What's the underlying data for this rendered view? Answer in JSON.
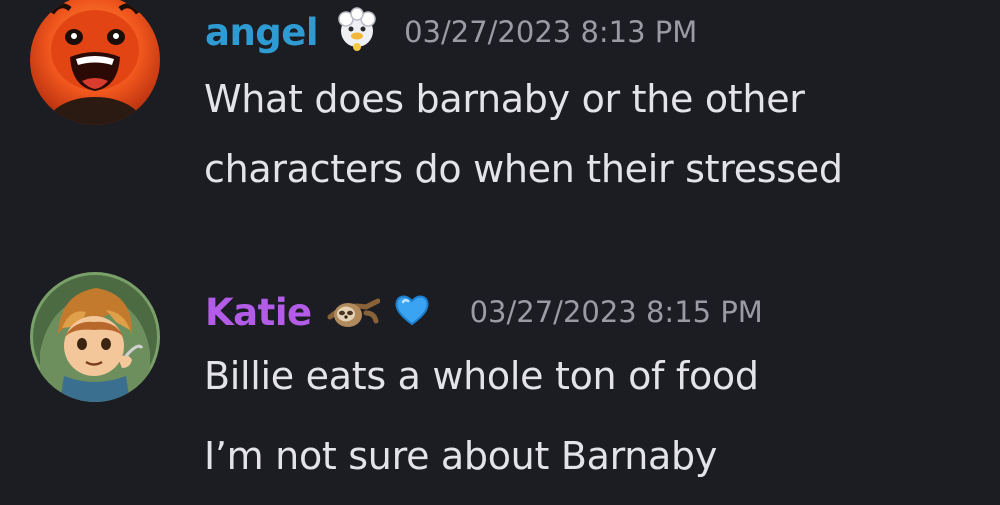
{
  "messages": [
    {
      "author": {
        "name": "angel",
        "color": "#2f9bd3",
        "avatar": "orange-screaming-character-avatar",
        "badges": [
          "white-flower-duck-icon"
        ]
      },
      "timestamp": "03/27/2023 8:13 PM",
      "lines": [
        "What does barnaby or the other",
        "characters do when their stressed"
      ]
    },
    {
      "author": {
        "name": "Katie",
        "color": "#b35ce8",
        "avatar": "brown-haired-character-avatar",
        "badges": [
          "sloth-emoji-icon",
          "blue-heart-icon"
        ]
      },
      "timestamp": "03/27/2023 8:15 PM",
      "lines": [
        "Billie eats a whole ton of food",
        "I’m not sure about Barnaby"
      ]
    }
  ],
  "colors": {
    "background": "#1c1d22",
    "message_text": "#e4e4e8",
    "timestamp": "#9b9ca3"
  }
}
